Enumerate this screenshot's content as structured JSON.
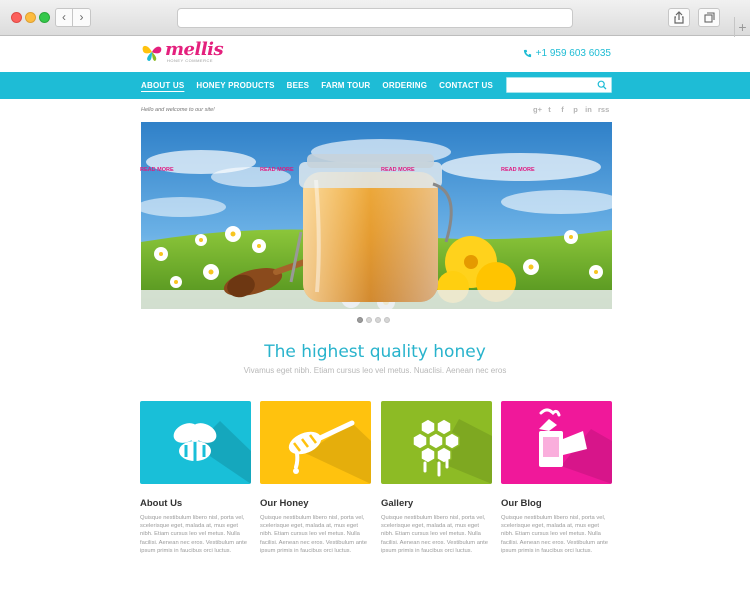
{
  "browser": {
    "back_glyph": "‹",
    "forward_glyph": "›",
    "new_tab_glyph": "+"
  },
  "brand": {
    "name": "mellis",
    "tagline": "HONEY COMMERCE",
    "colors": {
      "pink": "#e4207d",
      "cyan": "#1ebcd6",
      "yellow": "#ffc20e",
      "green": "#8dbb25",
      "magenta": "#f0189a"
    }
  },
  "header": {
    "phone": "+1 959 603 6035",
    "phone_icon": "phone-icon"
  },
  "nav": {
    "items": [
      {
        "label": "About Us",
        "active": true
      },
      {
        "label": "Honey Products",
        "active": false
      },
      {
        "label": "Bees",
        "active": false
      },
      {
        "label": "Farm Tour",
        "active": false
      },
      {
        "label": "Ordering",
        "active": false
      },
      {
        "label": "Contact Us",
        "active": false
      }
    ],
    "search_placeholder": "",
    "search_icon": "search-icon"
  },
  "welcome": "Hello and welcome to our site!",
  "social": [
    "g+",
    "t",
    "f",
    "p",
    "in",
    "rss"
  ],
  "hero": {
    "slide_count": 4,
    "active_slide": 1
  },
  "intro": {
    "title": "The highest quality honey",
    "subtitle": "Vivamus eget nibh. Etiam cursus leo vel metus. Nuaclisi. Aenean nec eros"
  },
  "cards": [
    {
      "title": "About Us",
      "icon": "bee-icon",
      "color": "#19bfd8",
      "text": "Quisque nestibulum libero nisl, porta vel, scelerisque eget, malada at, mus eget nibh. Etiam cursus leo vel metus. Nulla facilisi. Aenean nec eros. Vestibulum ante ipsum primis in faucibus orci luctus.",
      "link": "Read More"
    },
    {
      "title": "Our Honey",
      "icon": "honey-dipper-icon",
      "color": "#ffc20e",
      "text": "Quisque nestibulum libero nisl, porta vel, scelerisque eget, malada at, mus eget nibh. Etiam cursus leo vel metus. Nulla facilisi. Aenean nec eros. Vestibulum ante ipsum primis in faucibus orci luctus.",
      "link": "Read More"
    },
    {
      "title": "Gallery",
      "icon": "honeycomb-icon",
      "color": "#8dbb25",
      "text": "Quisque nestibulum libero nisl, porta vel, scelerisque eget, malada at, mus eget nibh. Etiam cursus leo vel metus. Nulla facilisi. Aenean nec eros. Vestibulum ante ipsum primis in faucibus orci luctus.",
      "link": "Read More"
    },
    {
      "title": "Our Blog",
      "icon": "bee-smoker-icon",
      "color": "#f0189a",
      "text": "Quisque nestibulum libero nisl, porta vel, scelerisque eget, malada at, mus eget nibh. Etiam cursus leo vel metus. Nulla facilisi. Aenean nec eros. Vestibulum ante ipsum primis in faucibus orci luctus.",
      "link": "Read More"
    }
  ]
}
